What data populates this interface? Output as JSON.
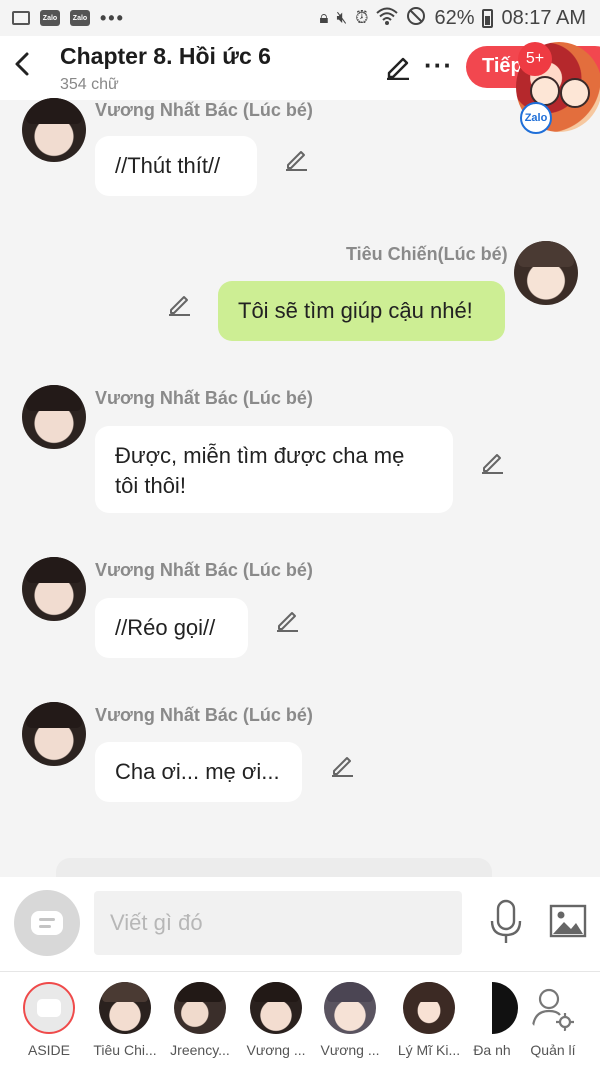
{
  "status_bar": {
    "app_badges": [
      "Zalo",
      "Zalo"
    ],
    "battery": "62%",
    "time": "08:17 AM"
  },
  "header": {
    "title": "Chapter 8. Hồi ức 6",
    "subtitle": "354 chữ",
    "next_label": "Tiếp",
    "badge": "5+",
    "floating_app": "Zalo"
  },
  "messages": [
    {
      "speaker": "Vương Nhất Bác (Lúc bé)",
      "text": "//Thút thít//",
      "side": "left"
    },
    {
      "speaker": "Tiêu Chiến(Lúc bé)",
      "text": "Tôi sẽ tìm giúp cậu nhé!",
      "side": "right"
    },
    {
      "speaker": "Vương Nhất Bác (Lúc bé)",
      "text": "Được, miễn tìm được cha mẹ tôi thôi!",
      "side": "left"
    },
    {
      "speaker": "Vương Nhất Bác (Lúc bé)",
      "text": "//Réo gọi//",
      "side": "left"
    },
    {
      "speaker": "Vương Nhất Bác (Lúc bé)",
      "text": "Cha ơi... mẹ ơi...",
      "side": "left"
    }
  ],
  "composer": {
    "placeholder": "Viết gì đó"
  },
  "characters": [
    {
      "label": "ASIDE"
    },
    {
      "label": "Tiêu Chi..."
    },
    {
      "label": "Jreency..."
    },
    {
      "label": "Vương ..."
    },
    {
      "label": "Vương ..."
    },
    {
      "label": "Lý Mĩ Ki..."
    },
    {
      "label": "Đa nh"
    },
    {
      "label": "Quản lí"
    }
  ],
  "colors": {
    "accent": "#f2474f",
    "my_bubble": "#cdee94",
    "other_bubble": "#ffffff",
    "background": "#f4f4f4"
  }
}
